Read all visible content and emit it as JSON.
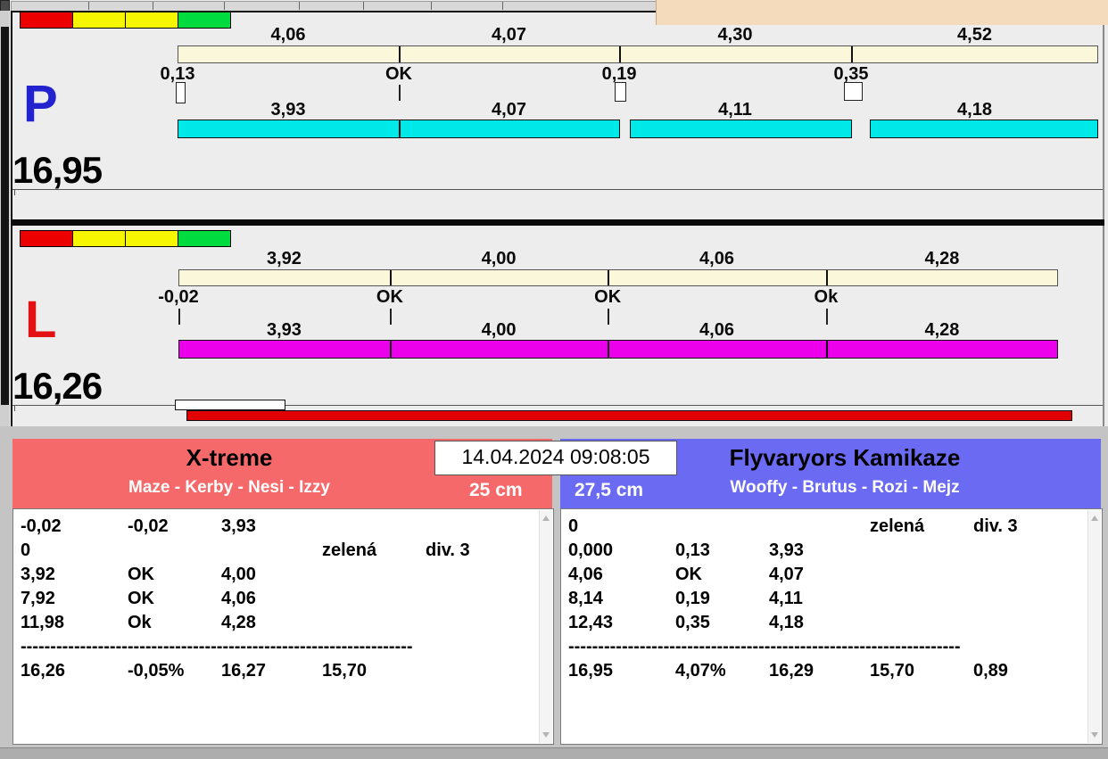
{
  "colors": {
    "cream_bar": "#FAF7DB",
    "lane_p_bar": "#00E9E9",
    "lane_l_bar": "#EC00EC",
    "lane_p_letter": "#2222CF",
    "lane_l_letter": "#E31111",
    "traffic_lights": [
      "#ED0000",
      "#F6F600",
      "#F6F600",
      "#00DC40"
    ],
    "header_left": "#F5696B",
    "header_right": "#6A6AF2",
    "progress_red": "#E00000",
    "peach_window": "#F3DBBB"
  },
  "lanes": {
    "p": {
      "label": "P",
      "total": "16,95",
      "splits_top": [
        "4,06",
        "4,07",
        "4,30",
        "4,52"
      ],
      "marks": [
        "0,13",
        "OK",
        "0,19",
        "0,35"
      ],
      "mark_widgets": [
        "box",
        "tick",
        "box",
        "box"
      ],
      "splits_bottom": [
        "3,93",
        "4,07",
        "4,11",
        "4,18"
      ]
    },
    "l": {
      "label": "L",
      "total": "16,26",
      "splits_top": [
        "3,92",
        "4,00",
        "4,06",
        "4,28"
      ],
      "marks": [
        "-0,02",
        "OK",
        "OK",
        "Ok"
      ],
      "mark_widgets": [
        "tick",
        "tick",
        "tick",
        "tick"
      ],
      "splits_bottom": [
        "3,93",
        "4,00",
        "4,06",
        "4,28"
      ]
    }
  },
  "timestamp": "14.04.2024 09:08:05",
  "teams": {
    "left": {
      "name": "X-treme",
      "dogs": "Maze - Kerby - Nesi - Izzy",
      "height": "25 cm",
      "rows": [
        [
          "-0,02",
          "-0,02",
          "3,93",
          "",
          ""
        ],
        [
          "0",
          "",
          "",
          "zelená",
          "div. 3"
        ],
        [
          "3,92",
          "OK",
          "4,00",
          "",
          ""
        ],
        [
          "7,92",
          "OK",
          "4,06",
          "",
          ""
        ],
        [
          "11,98",
          "Ok",
          "4,28",
          "",
          ""
        ]
      ],
      "separator": "------------------------------------------------------------------",
      "totals": [
        "16,26",
        "-0,05%",
        "16,27",
        "15,70",
        ""
      ]
    },
    "right": {
      "name": "Flyvaryors Kamikaze",
      "dogs": "Wooffy - Brutus - Rozi - Mejz",
      "height": "27,5 cm",
      "rows": [
        [
          "0",
          "",
          "",
          "zelená",
          "div. 3"
        ],
        [
          "0,000",
          "0,13",
          "3,93",
          "",
          ""
        ],
        [
          "4,06",
          "OK",
          "4,07",
          "",
          ""
        ],
        [
          "8,14",
          "0,19",
          "4,11",
          "",
          ""
        ],
        [
          "12,43",
          "0,35",
          "4,18",
          "",
          ""
        ]
      ],
      "separator": "------------------------------------------------------------------",
      "totals": [
        "16,95",
        "4,07%",
        "16,29",
        "15,70",
        "0,89"
      ]
    }
  }
}
